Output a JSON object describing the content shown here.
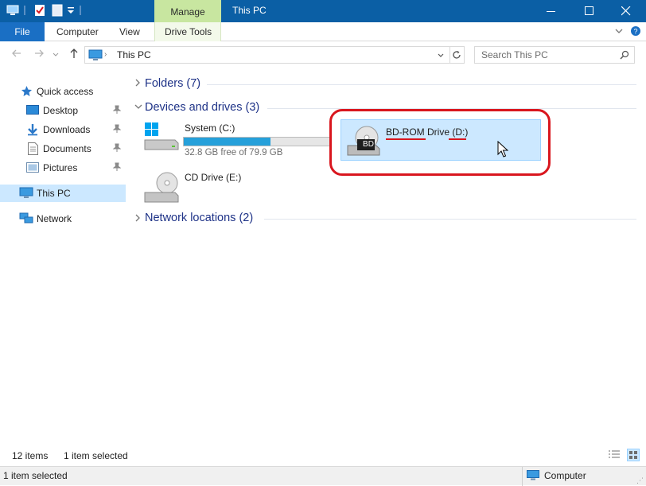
{
  "window": {
    "title": "This PC",
    "contextual_tab": "Manage",
    "accent": "#0b5fa5"
  },
  "ribbon": {
    "tabs": [
      {
        "label": "File"
      },
      {
        "label": "Computer"
      },
      {
        "label": "View"
      },
      {
        "label": "Drive Tools"
      }
    ]
  },
  "address": {
    "path": "This PC",
    "search_placeholder": "Search This PC"
  },
  "nav": {
    "quick_access": "Quick access",
    "items": [
      {
        "label": "Desktop",
        "icon": "desktop-icon",
        "pinned": true
      },
      {
        "label": "Downloads",
        "icon": "downloads-icon",
        "pinned": true
      },
      {
        "label": "Documents",
        "icon": "documents-icon",
        "pinned": true
      },
      {
        "label": "Pictures",
        "icon": "pictures-icon",
        "pinned": true
      }
    ],
    "this_pc": "This PC",
    "network": "Network"
  },
  "content": {
    "groups": {
      "folders": "Folders (7)",
      "devices": "Devices and drives (3)",
      "network": "Network locations (2)"
    },
    "drives": {
      "c": {
        "name": "System (C:)",
        "free_text": "32.8 GB free of 79.9 GB",
        "used_fraction": 0.59
      },
      "d": {
        "name": "BD-ROM Drive (D:)",
        "badge": "BD"
      },
      "e": {
        "name": "CD Drive (E:)"
      }
    }
  },
  "status": {
    "items_count": "12 items",
    "selected_count": "1 item selected",
    "bottom_selected": "1 item selected",
    "zone": "Computer"
  }
}
